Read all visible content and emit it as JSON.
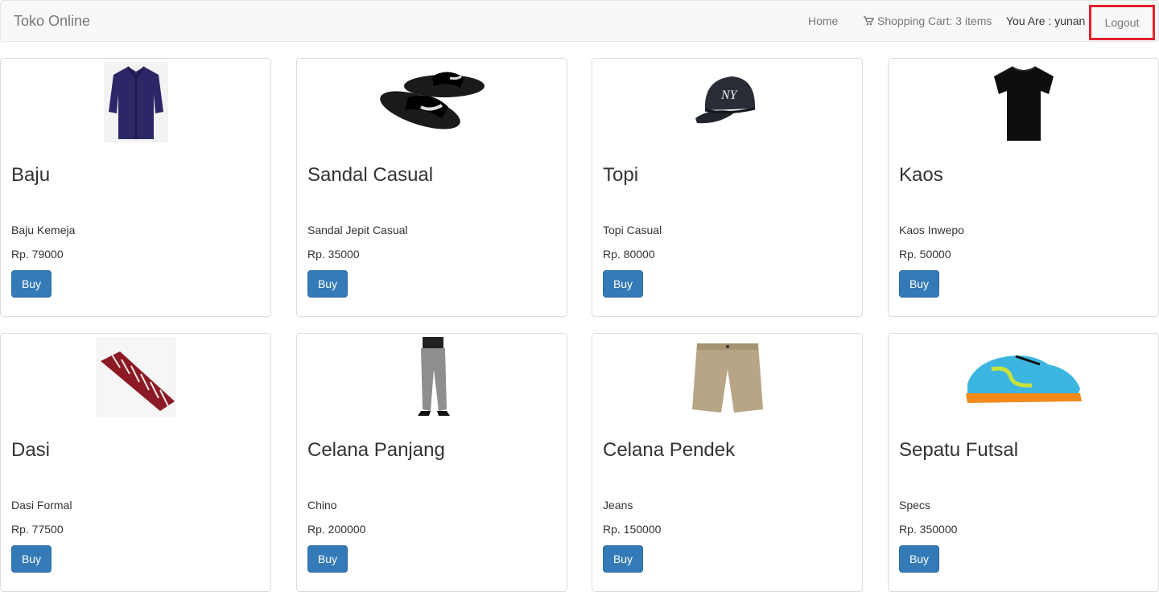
{
  "navbar": {
    "brand": "Toko Online",
    "home": "Home",
    "cart": "Shopping Cart: 3 items",
    "user": "You Are : yunan",
    "logout": "Logout",
    "logout_highlight_color": "#e3222b"
  },
  "products": [
    {
      "title": "Baju",
      "desc": "Baju Kemeja",
      "price": "Rp. 79000",
      "buy": "Buy",
      "image": "navy-shirt"
    },
    {
      "title": "Sandal Casual",
      "desc": "Sandal Jepit Casual",
      "price": "Rp. 35000",
      "buy": "Buy",
      "image": "black-slides"
    },
    {
      "title": "Topi",
      "desc": "Topi Casual",
      "price": "Rp. 80000",
      "buy": "Buy",
      "image": "ny-cap"
    },
    {
      "title": "Kaos",
      "desc": "Kaos Inwepo",
      "price": "Rp. 50000",
      "buy": "Buy",
      "image": "black-tshirt"
    },
    {
      "title": "Dasi",
      "desc": "Dasi Formal",
      "price": "Rp. 77500",
      "buy": "Buy",
      "image": "striped-tie"
    },
    {
      "title": "Celana Panjang",
      "desc": "Chino",
      "price": "Rp. 200000",
      "buy": "Buy",
      "image": "grey-trousers"
    },
    {
      "title": "Celana Pendek",
      "desc": "Jeans",
      "price": "Rp. 150000",
      "buy": "Buy",
      "image": "khaki-shorts"
    },
    {
      "title": "Sepatu Futsal",
      "desc": "Specs",
      "price": "Rp. 350000",
      "buy": "Buy",
      "image": "futsal-shoe"
    }
  ],
  "colors": {
    "buy_button": "#337ab7",
    "navbar_bg": "#f8f8f8"
  }
}
